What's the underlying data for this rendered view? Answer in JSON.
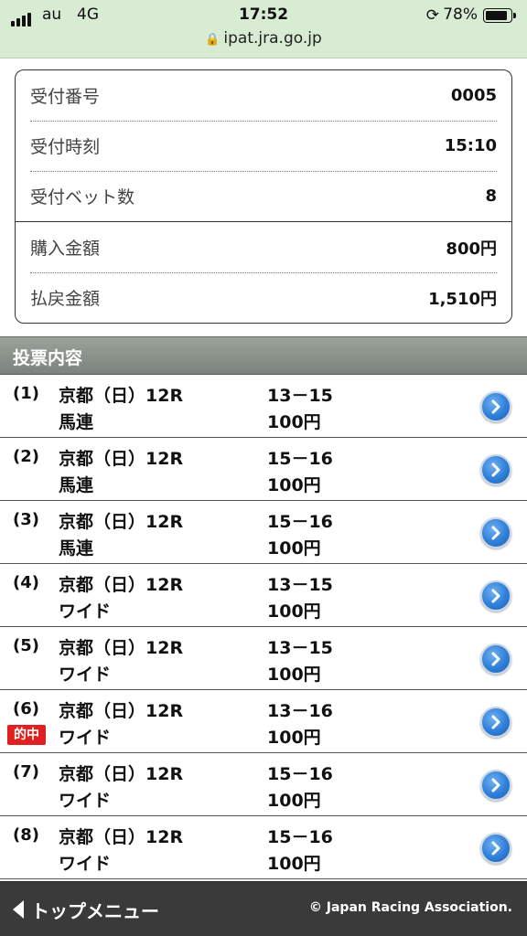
{
  "status_bar": {
    "carrier": "au",
    "network": "4G",
    "time": "17:52",
    "battery": "78%",
    "battery_level": 0.78,
    "url": "ipat.jra.go.jp"
  },
  "summary": {
    "rows": [
      {
        "label": "受付番号",
        "value": "0005"
      },
      {
        "label": "受付時刻",
        "value": "15:10"
      },
      {
        "label": "受付ベット数",
        "value": "8"
      },
      {
        "label": "購入金額",
        "value": "800円"
      },
      {
        "label": "払戻金額",
        "value": "1,510円"
      }
    ]
  },
  "section_title": "投票内容",
  "hit_badge": "的中",
  "bets": [
    {
      "num": "(1)",
      "race": "京都（日）12R",
      "type": "馬連",
      "combo": "13－15",
      "amount": "100円",
      "hit": false
    },
    {
      "num": "(2)",
      "race": "京都（日）12R",
      "type": "馬連",
      "combo": "15－16",
      "amount": "100円",
      "hit": false
    },
    {
      "num": "(3)",
      "race": "京都（日）12R",
      "type": "馬連",
      "combo": "15－16",
      "amount": "100円",
      "hit": false
    },
    {
      "num": "(4)",
      "race": "京都（日）12R",
      "type": "ワイド",
      "combo": "13－15",
      "amount": "100円",
      "hit": false
    },
    {
      "num": "(5)",
      "race": "京都（日）12R",
      "type": "ワイド",
      "combo": "13－15",
      "amount": "100円",
      "hit": false
    },
    {
      "num": "(6)",
      "race": "京都（日）12R",
      "type": "ワイド",
      "combo": "13－16",
      "amount": "100円",
      "hit": true
    },
    {
      "num": "(7)",
      "race": "京都（日）12R",
      "type": "ワイド",
      "combo": "15－16",
      "amount": "100円",
      "hit": false
    },
    {
      "num": "(8)",
      "race": "京都（日）12R",
      "type": "ワイド",
      "combo": "15－16",
      "amount": "100円",
      "hit": false
    }
  ],
  "footer": {
    "back_label": "トップメニュー",
    "copyright": "© Japan Racing Association."
  }
}
